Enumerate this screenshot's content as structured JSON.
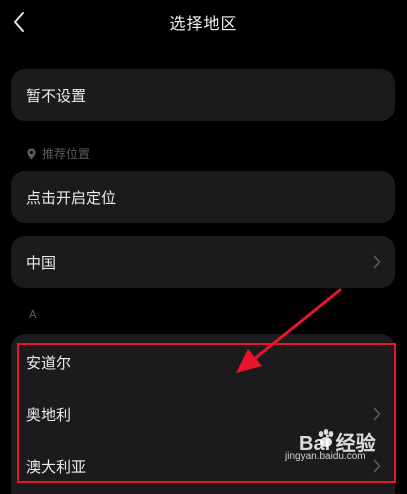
{
  "header": {
    "title": "选择地区"
  },
  "no_setting": {
    "label": "暂不设置"
  },
  "recommend": {
    "section_label": "推荐位置",
    "enable_location_label": "点击开启定位"
  },
  "china": {
    "label": "中国"
  },
  "index_letter": "A",
  "countries": [
    {
      "label": "安道尔",
      "has_chevron": false
    },
    {
      "label": "奥地利",
      "has_chevron": true
    },
    {
      "label": "澳大利亚",
      "has_chevron": true
    }
  ],
  "annotation": {
    "highlight_color": "#e8152a"
  },
  "watermark": {
    "brand": "Bai  经验",
    "url": "jingyan.baidu.com"
  },
  "icons": [
    "back-chevron-icon",
    "location-pin-icon",
    "chevron-right-icon"
  ],
  "colors": {
    "background": "#000000",
    "card": "#1b1b1d",
    "text": "#ececec",
    "muted": "#5c5c5e"
  }
}
